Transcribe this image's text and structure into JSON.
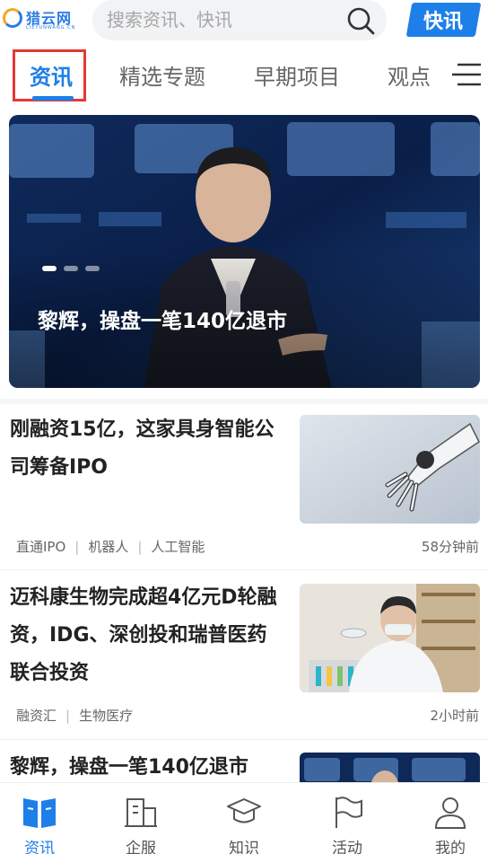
{
  "header": {
    "logo_text": "猎云网",
    "logo_sub": "LIEYUNWANG.CN",
    "search_placeholder": "搜索资讯、快讯",
    "flash_button": "快讯"
  },
  "tabs": [
    {
      "label": "资讯",
      "active": true
    },
    {
      "label": "精选专题",
      "active": false
    },
    {
      "label": "早期项目",
      "active": false
    },
    {
      "label": "观点",
      "active": false
    }
  ],
  "banner": {
    "title": "黎辉，操盘一笔140亿退市",
    "slide_count": 3,
    "active_slide": 1
  },
  "articles": [
    {
      "title": "刚融资15亿，这家具身智能公司筹备IPO",
      "tags": [
        "直通IPO",
        "机器人",
        "人工智能"
      ],
      "time": "58分钟前",
      "thumb": "robot-hand-image"
    },
    {
      "title": "迈科康生物完成超4亿元D轮融资，IDG、深创投和瑞普医药联合投资",
      "tags": [
        "融资汇",
        "生物医疗"
      ],
      "time": "2小时前",
      "thumb": "lab-scientist-image"
    },
    {
      "title": "黎辉，操盘一笔140亿退市",
      "tags": [],
      "time": "",
      "thumb": "speaker-stage-image"
    }
  ],
  "bottom_nav": [
    {
      "label": "资讯",
      "icon": "news-book-icon",
      "active": true
    },
    {
      "label": "企服",
      "icon": "building-icon",
      "active": false
    },
    {
      "label": "知识",
      "icon": "graduation-cap-icon",
      "active": false
    },
    {
      "label": "活动",
      "icon": "flag-icon",
      "active": false
    },
    {
      "label": "我的",
      "icon": "user-icon",
      "active": false
    }
  ],
  "colors": {
    "accent": "#1f7fe8",
    "highlight_box": "#e53935"
  }
}
